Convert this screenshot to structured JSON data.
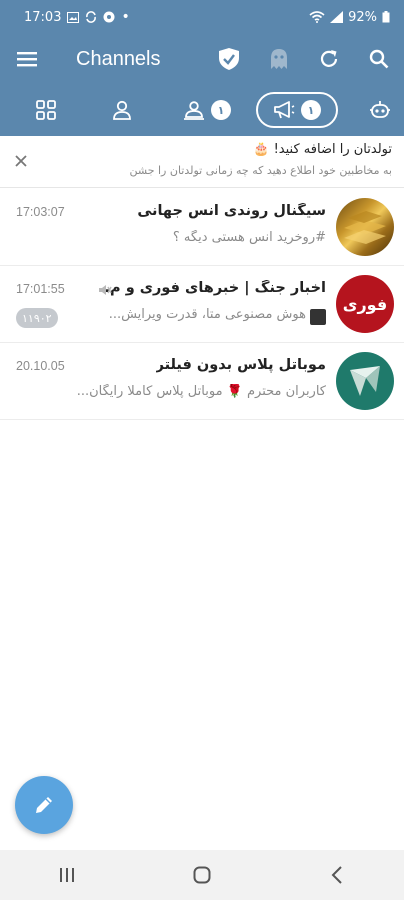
{
  "status_bar": {
    "time": "17:03",
    "battery": "92%"
  },
  "header": {
    "title": "Channels"
  },
  "tabs": [
    {
      "name": "all",
      "badge": ""
    },
    {
      "name": "private",
      "badge": ""
    },
    {
      "name": "groups",
      "badge": "١"
    },
    {
      "name": "channels",
      "badge": "١"
    },
    {
      "name": "bots",
      "badge": ""
    }
  ],
  "banner": {
    "title": "تولدتان را اضافه کنید! 🎂",
    "subtitle": "به مخاطبین خود اطلاع دهید که چه زمانی تولدتان را جشن"
  },
  "chats": [
    {
      "name": "سیگنال روندی انس جهانی",
      "message": "#روخرید انس هستی دیگه ؟",
      "time": "17:03:07",
      "unread": "",
      "muted": false,
      "avatar": "gold-bars"
    },
    {
      "name": "اخبار جنگ | خبرهای فوری و م...",
      "message": "هوش مصنوعی متا، قدرت ویرایش...",
      "time": "17:01:55",
      "unread": "۱۱۹۰۲",
      "muted": true,
      "avatar_text": "فوری"
    },
    {
      "name": "موباتل پلاس بدون فیلتر",
      "message": "کاربران محترم 🌹 موباتل پلاس کاملا رایگان...",
      "time": "20.10.05",
      "unread": "",
      "muted": false,
      "avatar": "mobatel-logo"
    }
  ],
  "colors": {
    "header": "#5b87ad",
    "fab": "#5aa4df",
    "badge": "#c5c9ce"
  }
}
